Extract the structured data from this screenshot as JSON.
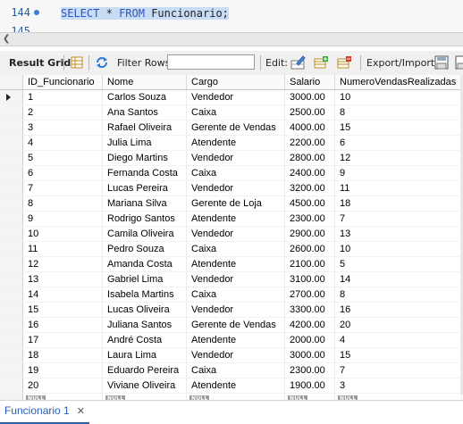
{
  "editor": {
    "lines": [
      {
        "number": "144",
        "sql_select": "SELECT",
        "sql_star": "*",
        "sql_from": "FROM",
        "table_name": "Funcionario;"
      },
      {
        "number": "145"
      }
    ]
  },
  "toolbar": {
    "result_grid_label": "Result Grid",
    "filter_rows_label": "Filter Rows:",
    "filter_rows_value": "",
    "edit_label": "Edit:",
    "export_import_label": "Export/Import:"
  },
  "grid": {
    "columns": [
      "ID_Funcionario",
      "Nome",
      "Cargo",
      "Salario",
      "NumeroVendasRealizadas"
    ],
    "rows": [
      [
        "1",
        "Carlos Souza",
        "Vendedor",
        "3000.00",
        "10"
      ],
      [
        "2",
        "Ana Santos",
        "Caixa",
        "2500.00",
        "8"
      ],
      [
        "3",
        "Rafael Oliveira",
        "Gerente de Vendas",
        "4000.00",
        "15"
      ],
      [
        "4",
        "Julia Lima",
        "Atendente",
        "2200.00",
        "6"
      ],
      [
        "5",
        "Diego Martins",
        "Vendedor",
        "2800.00",
        "12"
      ],
      [
        "6",
        "Fernanda Costa",
        "Caixa",
        "2400.00",
        "9"
      ],
      [
        "7",
        "Lucas Pereira",
        "Vendedor",
        "3200.00",
        "11"
      ],
      [
        "8",
        "Mariana Silva",
        "Gerente de Loja",
        "4500.00",
        "18"
      ],
      [
        "9",
        "Rodrigo Santos",
        "Atendente",
        "2300.00",
        "7"
      ],
      [
        "10",
        "Camila Oliveira",
        "Vendedor",
        "2900.00",
        "13"
      ],
      [
        "11",
        "Pedro Souza",
        "Caixa",
        "2600.00",
        "10"
      ],
      [
        "12",
        "Amanda Costa",
        "Atendente",
        "2100.00",
        "5"
      ],
      [
        "13",
        "Gabriel Lima",
        "Vendedor",
        "3100.00",
        "14"
      ],
      [
        "14",
        "Isabela Martins",
        "Caixa",
        "2700.00",
        "8"
      ],
      [
        "15",
        "Lucas Oliveira",
        "Vendedor",
        "3300.00",
        "16"
      ],
      [
        "16",
        "Juliana Santos",
        "Gerente de Vendas",
        "4200.00",
        "20"
      ],
      [
        "17",
        "André Costa",
        "Atendente",
        "2000.00",
        "4"
      ],
      [
        "18",
        "Laura Lima",
        "Vendedor",
        "3000.00",
        "15"
      ],
      [
        "19",
        "Eduardo Pereira",
        "Caixa",
        "2300.00",
        "7"
      ],
      [
        "20",
        "Viviane Oliveira",
        "Atendente",
        "1900.00",
        "3"
      ]
    ],
    "null_label": "NULL"
  },
  "tabs": [
    {
      "label": "Funcionario 1",
      "close": "✕"
    }
  ]
}
